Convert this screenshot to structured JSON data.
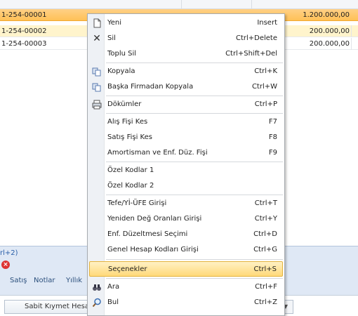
{
  "grid": {
    "rows": [
      {
        "code": "1-254-00001",
        "amount": "1.200.000,00"
      },
      {
        "code": "1-254-00002",
        "amount": "200.000,00"
      },
      {
        "code": "1-254-00003",
        "amount": "200.000,00"
      }
    ]
  },
  "bottom": {
    "shortcut_hint": "rl+2)",
    "tabs": [
      "Satış",
      "Notlar",
      "Yıllık"
    ],
    "footer_button": "Sabit Kıymet Hesap"
  },
  "context_menu": {
    "items": [
      {
        "label": "Yeni",
        "shortcut": "Insert",
        "icon": "new-document-icon"
      },
      {
        "label": "Sil",
        "shortcut": "Ctrl+Delete",
        "icon": "delete-x-icon"
      },
      {
        "label": "Toplu Sil",
        "shortcut": "Ctrl+Shift+Del",
        "icon": ""
      },
      {
        "label": "Kopyala",
        "shortcut": "Ctrl+K",
        "icon": "copy-icon"
      },
      {
        "label": "Başka Firmadan Kopyala",
        "shortcut": "Ctrl+W",
        "icon": "copy-icon"
      },
      {
        "label": "Dökümler",
        "shortcut": "Ctrl+P",
        "icon": "print-icon"
      },
      {
        "label": "Alış Fişi Kes",
        "shortcut": "F7",
        "icon": ""
      },
      {
        "label": "Satış Fişi Kes",
        "shortcut": "F8",
        "icon": ""
      },
      {
        "label": "Amortisman ve Enf. Düz. Fişi",
        "shortcut": "F9",
        "icon": ""
      },
      {
        "label": "Özel Kodlar 1",
        "shortcut": "",
        "icon": ""
      },
      {
        "label": "Özel Kodlar 2",
        "shortcut": "",
        "icon": ""
      },
      {
        "label": "Tefe/Yİ-ÜFE Girişi",
        "shortcut": "Ctrl+T",
        "icon": ""
      },
      {
        "label": "Yeniden Değ Oranları Girişi",
        "shortcut": "Ctrl+Y",
        "icon": ""
      },
      {
        "label": "Enf. Düzeltmesi Seçimi",
        "shortcut": "Ctrl+D",
        "icon": ""
      },
      {
        "label": "Genel Hesap Kodları Girişi",
        "shortcut": "Ctrl+G",
        "icon": ""
      },
      {
        "label": "Seçenekler",
        "shortcut": "Ctrl+S",
        "icon": ""
      },
      {
        "label": "Ara",
        "shortcut": "Ctrl+F",
        "icon": "binoculars-icon"
      },
      {
        "label": "Bul",
        "shortcut": "Ctrl+Z",
        "icon": "search-icon"
      }
    ],
    "selected": "Seçenekler"
  },
  "colors": {
    "selected_row": "#ffc156",
    "menu_highlight": "#ffd97a",
    "accent": "#2a5fa8"
  }
}
